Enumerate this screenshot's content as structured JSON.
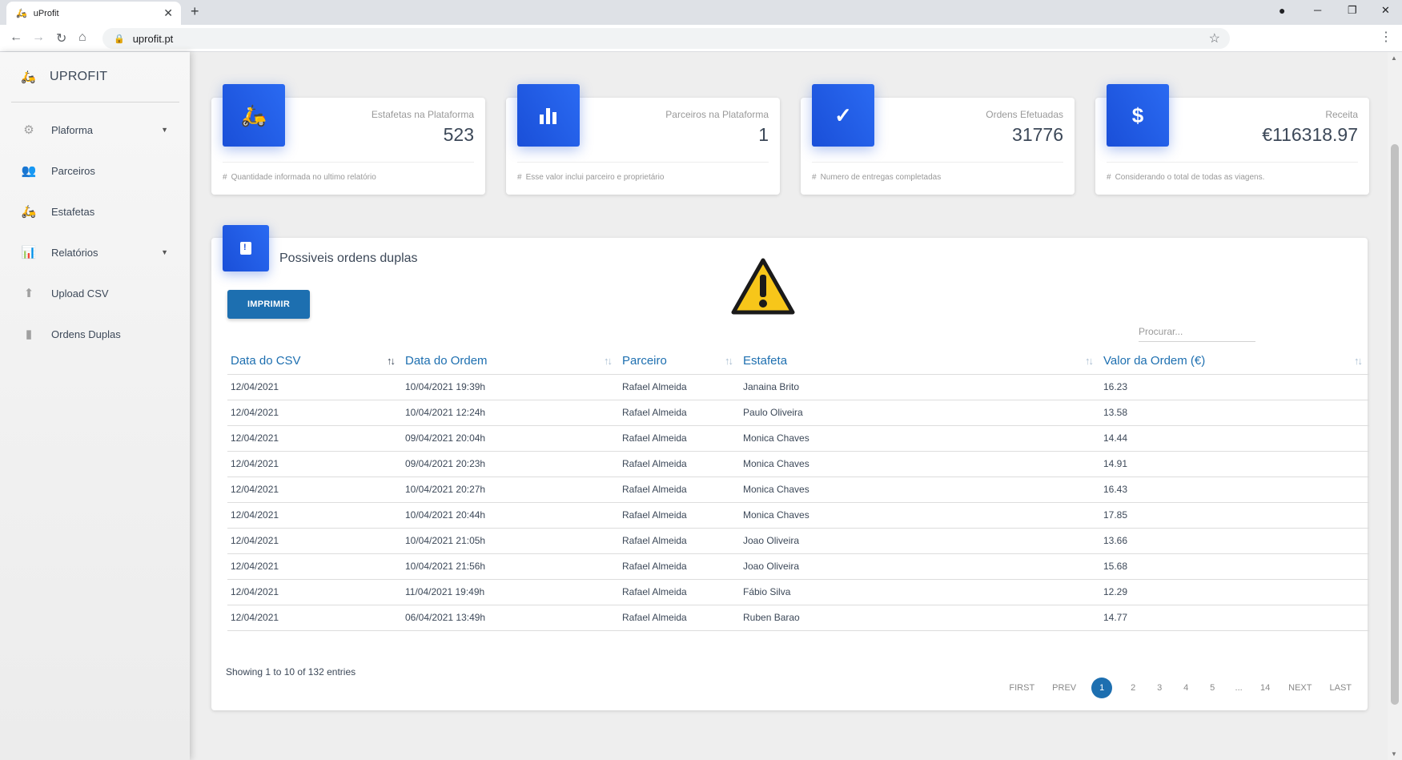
{
  "browser": {
    "tab_title": "uProfit",
    "tab_close": "✕",
    "new_tab": "+",
    "url": "uprofit.pt"
  },
  "sidebar": {
    "brand": "UPROFIT",
    "items": [
      {
        "label": "Plaforma",
        "icon": "gear-icon",
        "has_caret": true
      },
      {
        "label": "Parceiros",
        "icon": "people-icon",
        "has_caret": false
      },
      {
        "label": "Estafetas",
        "icon": "scooter-icon",
        "has_caret": false
      },
      {
        "label": "Relatórios",
        "icon": "bar-chart-icon",
        "has_caret": true
      },
      {
        "label": "Upload CSV",
        "icon": "upload-icon",
        "has_caret": false
      },
      {
        "label": "Ordens Duplas",
        "icon": "warning-doc-icon",
        "has_caret": false
      }
    ]
  },
  "stats": [
    {
      "label": "Estafetas na Plataforma",
      "value": "523",
      "foot": "Quantidade informada no ultimo relatório",
      "icon": "scooter-icon"
    },
    {
      "label": "Parceiros na Plataforma",
      "value": "1",
      "foot": "Esse valor inclui parceiro e proprietário",
      "icon": "bar-chart-icon"
    },
    {
      "label": "Ordens Efetuadas",
      "value": "31776",
      "foot": "Numero de entregas completadas",
      "icon": "check-icon"
    },
    {
      "label": "Receita",
      "value": "€116318.97",
      "foot": "Considerando o total de todas as viagens.",
      "icon": "dollar-icon"
    }
  ],
  "panel": {
    "title": "Possiveis ordens duplas",
    "print_label": "IMPRIMIR",
    "search_placeholder": "Procurar...",
    "columns": [
      "Data do CSV",
      "Data do Ordem",
      "Parceiro",
      "Estafeta",
      "Valor da Ordem (€)"
    ],
    "rows": [
      [
        "12/04/2021",
        "10/04/2021 19:39h",
        "Rafael Almeida",
        "Janaina Brito",
        "16.23"
      ],
      [
        "12/04/2021",
        "10/04/2021 12:24h",
        "Rafael Almeida",
        "Paulo Oliveira",
        "13.58"
      ],
      [
        "12/04/2021",
        "09/04/2021 20:04h",
        "Rafael Almeida",
        "Monica Chaves",
        "14.44"
      ],
      [
        "12/04/2021",
        "09/04/2021 20:23h",
        "Rafael Almeida",
        "Monica Chaves",
        "14.91"
      ],
      [
        "12/04/2021",
        "10/04/2021 20:27h",
        "Rafael Almeida",
        "Monica Chaves",
        "16.43"
      ],
      [
        "12/04/2021",
        "10/04/2021 20:44h",
        "Rafael Almeida",
        "Monica Chaves",
        "17.85"
      ],
      [
        "12/04/2021",
        "10/04/2021 21:05h",
        "Rafael Almeida",
        "Joao Oliveira",
        "13.66"
      ],
      [
        "12/04/2021",
        "10/04/2021 21:56h",
        "Rafael Almeida",
        "Joao Oliveira",
        "15.68"
      ],
      [
        "12/04/2021",
        "11/04/2021 19:49h",
        "Rafael Almeida",
        "Fábio Silva",
        "12.29"
      ],
      [
        "12/04/2021",
        "06/04/2021 13:49h",
        "Rafael Almeida",
        "Ruben Barao",
        "14.77"
      ]
    ],
    "info": "Showing 1 to 10 of 132 entries",
    "pagination": [
      "FIRST",
      "PREV",
      "1",
      "2",
      "3",
      "4",
      "5",
      "...",
      "14",
      "NEXT",
      "LAST"
    ],
    "active_page": "1"
  },
  "colors": {
    "accent": "#1d6fb0",
    "icon_gradient_start": "#1a4fd8",
    "icon_gradient_end": "#2a6af2",
    "warning_yellow": "#f7c61a"
  }
}
